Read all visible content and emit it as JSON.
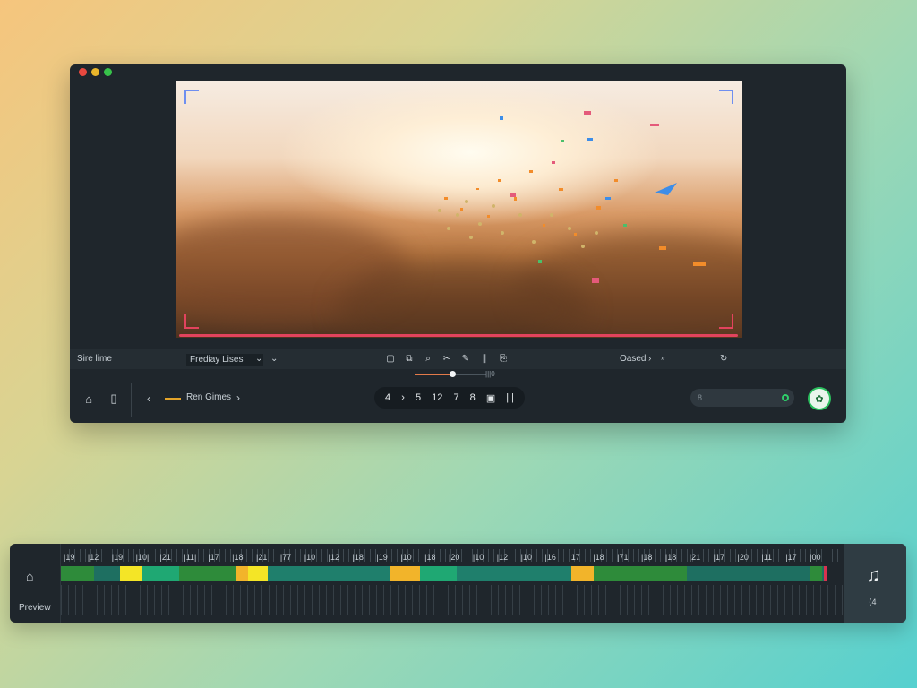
{
  "toolbar": {
    "left_label": "Sire lime",
    "dropdown_value": "Frediay Lises",
    "right_label": "Oased",
    "tools": [
      "▢",
      "⧉",
      "⌕",
      "✂",
      "✎",
      "∥",
      "⎘"
    ]
  },
  "scrub": {
    "value": 0.52,
    "tick_text": "|||0"
  },
  "bottom": {
    "render_label": "Ren Gimes",
    "pager": [
      "4",
      "›",
      "5",
      "12",
      "7",
      "8",
      "▣",
      "|||"
    ],
    "search_placeholder": "8"
  },
  "timeline": {
    "preview_label": "Preview",
    "music_label": "⟨4",
    "ruler": [
      "|19",
      "|12",
      "|19",
      "|10|",
      "|21",
      "|11|",
      "|17",
      "|18",
      "|21",
      "|77",
      "|10",
      "|12",
      "|18",
      "|19",
      "|10",
      "|18",
      "|20",
      "|10",
      "|12",
      "|10",
      "|16",
      "|17",
      "|18",
      "|71",
      "|18",
      "|18",
      "|21",
      "|17",
      "|20",
      "|11",
      "|17",
      "|00"
    ],
    "segments": [
      {
        "from": 0,
        "to": 0.043,
        "color": "#2e8b3a"
      },
      {
        "from": 0.077,
        "to": 0.107,
        "color": "#f4e526"
      },
      {
        "from": 0.107,
        "to": 0.155,
        "color": "#1fa873"
      },
      {
        "from": 0.155,
        "to": 0.229,
        "color": "#2e8b3a"
      },
      {
        "from": 0.229,
        "to": 0.245,
        "color": "#f2b42a"
      },
      {
        "from": 0.245,
        "to": 0.27,
        "color": "#f4e526"
      },
      {
        "from": 0.27,
        "to": 0.43,
        "color": "#1f7f6c"
      },
      {
        "from": 0.43,
        "to": 0.445,
        "color": "#f2b42a"
      },
      {
        "from": 0.445,
        "to": 0.47,
        "color": "#f2b42a"
      },
      {
        "from": 0.47,
        "to": 0.517,
        "color": "#1fa873"
      },
      {
        "from": 0.517,
        "to": 0.668,
        "color": "#1f7f6c"
      },
      {
        "from": 0.668,
        "to": 0.697,
        "color": "#f2b42a"
      },
      {
        "from": 0.697,
        "to": 0.818,
        "color": "#2e8b3a"
      },
      {
        "from": 0.98,
        "to": 0.995,
        "color": "#2e8b3a"
      }
    ]
  },
  "colors": {
    "accent_red": "#e2435d",
    "accent_blue": "#6f8ff0",
    "accent_green": "#2bbf5e"
  }
}
